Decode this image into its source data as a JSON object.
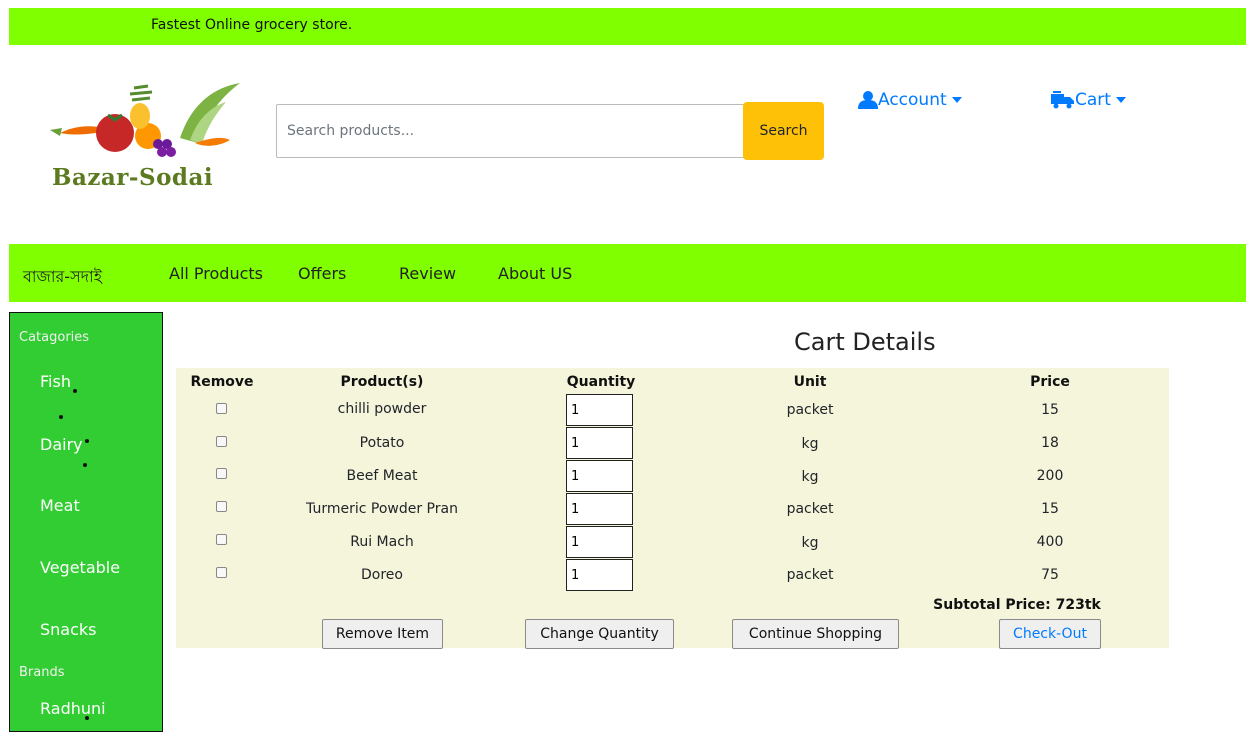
{
  "topbar": {
    "text": "Fastest Online grocery store."
  },
  "logo": {
    "text": "Bazar-Sodai"
  },
  "search": {
    "placeholder": "Search products...",
    "button_label": "Search"
  },
  "account": {
    "label": "Account",
    "icon": "user-icon"
  },
  "cart_menu": {
    "label": "Cart",
    "icon": "truck-icon"
  },
  "nav": {
    "brand": "বাজার-সদাই",
    "items": [
      "All Products",
      "Offers",
      "Review",
      "About US"
    ]
  },
  "sidebar": {
    "categories_heading": "Catagories",
    "categories": [
      "Fish",
      "Dairy",
      "Meat",
      "Vegetable",
      "Snacks"
    ],
    "brands_heading": "Brands",
    "brands": [
      "Radhuni"
    ]
  },
  "cart": {
    "title": "Cart Details",
    "headers": [
      "Remove",
      "Product(s)",
      "Quantity",
      "Unit",
      "Price"
    ],
    "rows": [
      {
        "product": "chilli powder",
        "quantity": "1",
        "unit": "packet",
        "price": "15"
      },
      {
        "product": "Potato",
        "quantity": "1",
        "unit": "kg",
        "price": "18"
      },
      {
        "product": "Beef Meat",
        "quantity": "1",
        "unit": "kg",
        "price": "200"
      },
      {
        "product": "Turmeric Powder Pran",
        "quantity": "1",
        "unit": "packet",
        "price": "15"
      },
      {
        "product": "Rui Mach",
        "quantity": "1",
        "unit": "kg",
        "price": "400"
      },
      {
        "product": "Doreo",
        "quantity": "1",
        "unit": "packet",
        "price": "75"
      }
    ],
    "subtotal": "Subtotal Price: 723tk",
    "buttons": {
      "remove": "Remove Item",
      "change": "Change Quantity",
      "continue": "Continue Shopping",
      "checkout": "Check-Out"
    }
  },
  "colors": {
    "lime": "#7fff00",
    "sidebar_green": "#32cd32",
    "search_yellow": "#ffc107",
    "link_blue": "#007bff",
    "panel_beige": "#f5f5dc"
  }
}
